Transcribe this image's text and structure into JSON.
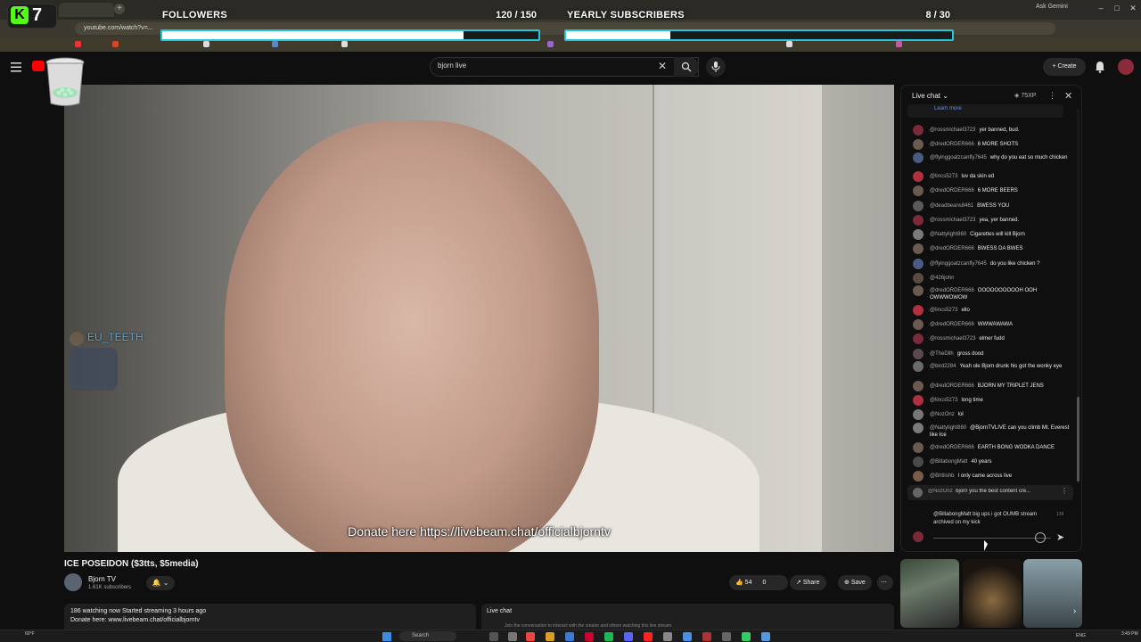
{
  "browser": {
    "url": "youtube.com/watch?v=...",
    "ask_gemini": "Ask Gemini"
  },
  "kick": {
    "count": "7",
    "logo": "K",
    "followers": {
      "title": "FOLLOWERS",
      "count_text": "120 / 150",
      "progress": 0.8
    },
    "subscribers": {
      "title": "YEARLY SUBSCRIBERS",
      "count_text": "8 / 30",
      "progress": 0.27
    }
  },
  "header": {
    "search_value": "bjorn live",
    "create_label": "Create"
  },
  "video": {
    "overlay_donate": "Donate here https://livebeam.chat/officialbjorntv",
    "overlay_user": "EU_TEETH",
    "title": "ICE POSEIDON ($3tts, $5media)",
    "channel_name": "Bjorn TV",
    "channel_subs": "1.61K subscribers",
    "likes": "54",
    "dislikes": "0",
    "share_label": "Share",
    "save_label": "Save",
    "desc_line1": "186 watching now  Started streaming 3 hours ago",
    "desc_line2": "Donate here: www.livebeam.chat/officialbjorntv",
    "livechat_label": "Live chat",
    "livechat_sub": "Join the conversation to interact with the creator and others watching this live stream."
  },
  "chat": {
    "title": "Live chat",
    "xp": "75XP",
    "pinned_top": "Learn more",
    "messages": [
      {
        "author": "@rossmichael3723",
        "text": "yer banned, bud.",
        "color": "#7a2a38"
      },
      {
        "author": "@dredORDER666",
        "text": "6 MORE SHOTS",
        "color": "#6a5a50"
      },
      {
        "author": "@flyinggoatzcanfly7645",
        "text": "why do you eat so much chicken",
        "color": "#4a5a80"
      },
      {
        "author": "@lincs5273",
        "text": "luv da skin ed",
        "color": "#b03040"
      },
      {
        "author": "@dredORDER666",
        "text": "6 MORE BEERS",
        "color": "#6a5a50"
      },
      {
        "author": "@deadbeans8461",
        "text": "BWESS YOU",
        "color": "#5a5a5a"
      },
      {
        "author": "@rossmichael3723",
        "text": "yea, yer banned.",
        "color": "#7a2a38"
      },
      {
        "author": "@Nattylight860",
        "text": "Cigarettes will kill Bjorn",
        "color": "#7a7a7a"
      },
      {
        "author": "@dredORDER666",
        "text": "BWESS DA BWES",
        "color": "#6a5a50"
      },
      {
        "author": "@flyinggoatzcanfly7645",
        "text": "do you like chicken ?",
        "color": "#4a5a80"
      },
      {
        "author": "@426john",
        "text": "",
        "color": "#5a4a40"
      },
      {
        "author": "@dredORDER666",
        "text": "OOOOOOOOOOH OOH OWWWOWOW",
        "color": "#6a5a50"
      },
      {
        "author": "@lincs5273",
        "text": "ello",
        "color": "#b03040"
      },
      {
        "author": "@dredORDER666",
        "text": "WWWAWAWA",
        "color": "#6a5a50"
      },
      {
        "author": "@rossmichael3723",
        "text": "elmer fudd",
        "color": "#7a2a38"
      },
      {
        "author": "@TheDllh",
        "text": "gross dood",
        "color": "#5a4a50"
      },
      {
        "author": "@bird2284",
        "text": "Yeah ole Bjorn drunk his got the wonky eye",
        "color": "#6a6a6a"
      },
      {
        "author": "@dredORDER666",
        "text": "BJORN MY TRIPLET JENS",
        "color": "#6a5a50"
      },
      {
        "author": "@lincs5273",
        "text": "long time",
        "color": "#b03040"
      },
      {
        "author": "@NozOnz",
        "text": "lol",
        "color": "#777777"
      },
      {
        "author": "@Nattylight860",
        "text": "@BjornTVLIVE can you climb Mt. Everest like Ice",
        "color": "#7a7a7a"
      },
      {
        "author": "@dredORDER666",
        "text": "EARTH BONG WODKA DANCE",
        "color": "#6a5a50"
      },
      {
        "author": "@BillabongMatt",
        "text": "40 years",
        "color": "#4a4a4a"
      },
      {
        "author": "@Britlishb",
        "text": "I only came across live",
        "color": "#7a5a4a"
      }
    ],
    "pinned_msg_author": "@NozOnz",
    "pinned_msg_text": "bjorn you the best content cre...",
    "input_text": "@BillabongMatt big ups i got OUMB stream archived on my kick",
    "input_count": "139"
  },
  "taskbar": {
    "weather": "60°F",
    "search_label": "Search",
    "lang": "ENG",
    "time": "3:49 PM"
  }
}
